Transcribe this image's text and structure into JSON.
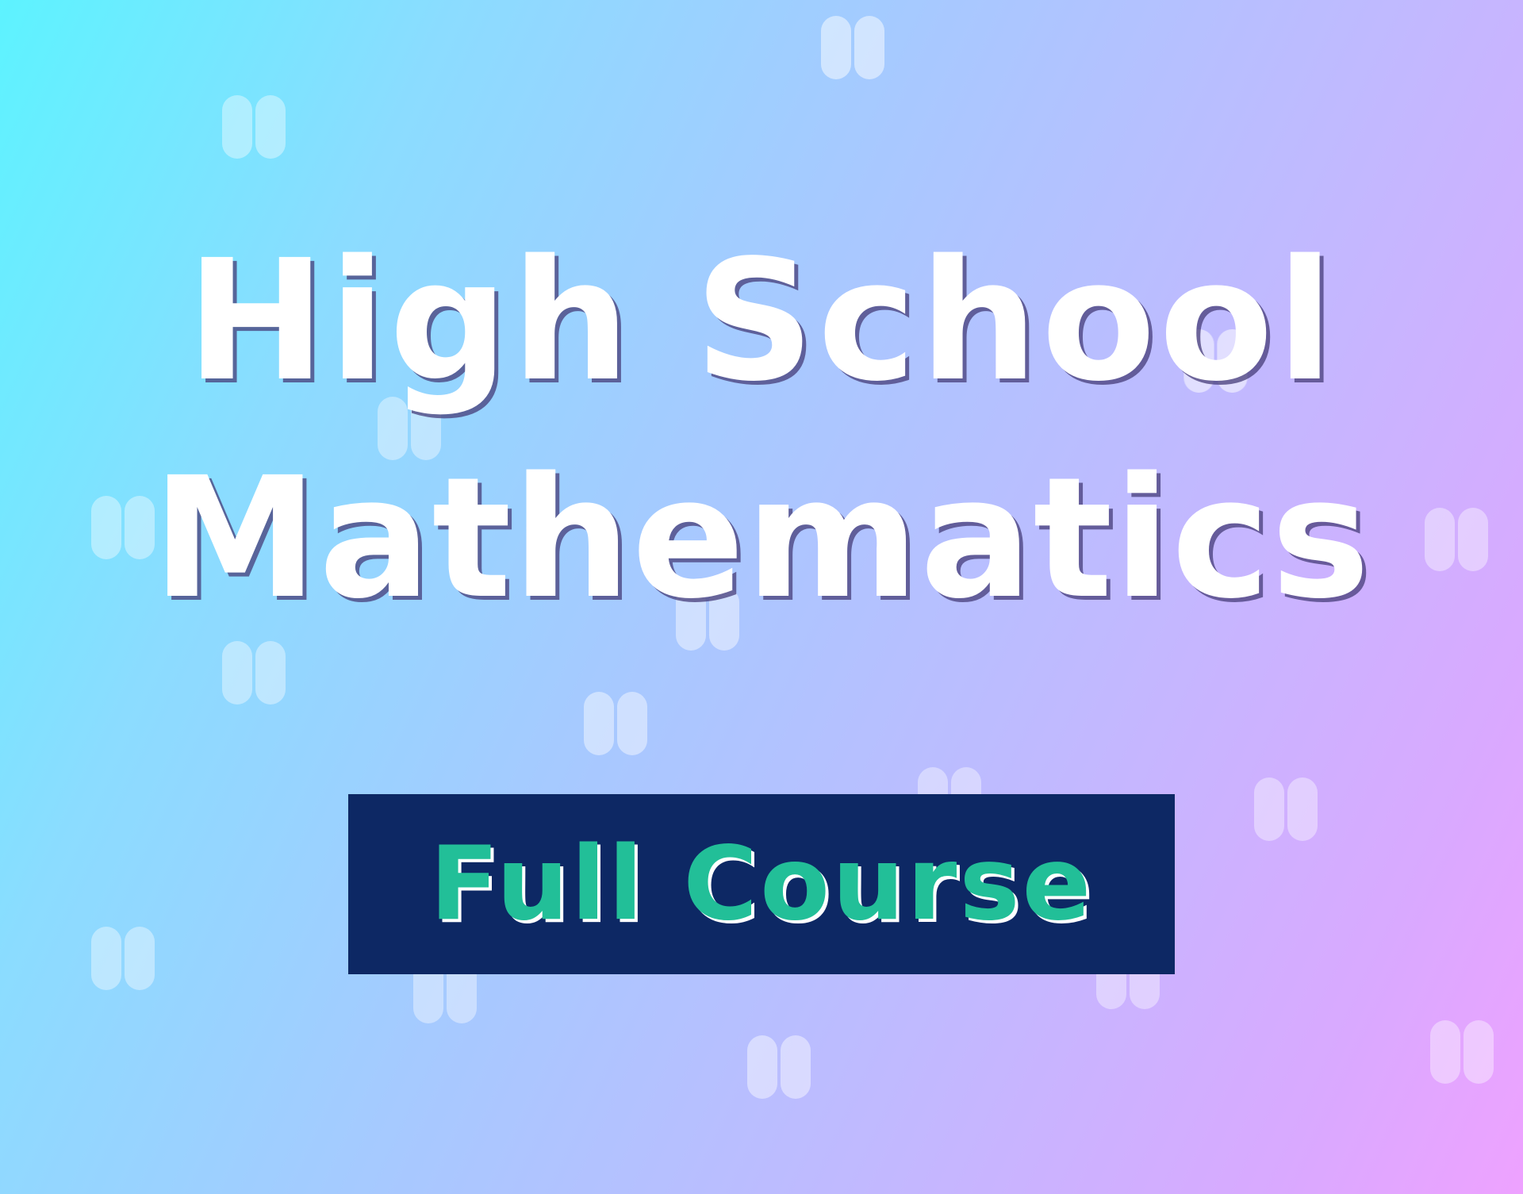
{
  "title": {
    "line1": "High School",
    "line2": "Mathematics"
  },
  "badge": {
    "label": "Full Course"
  },
  "colors": {
    "gradient_start": "#5df3ff",
    "gradient_end": "#eea2ff",
    "title_text": "#ffffff",
    "badge_background": "#0d2864",
    "badge_text": "#22bf98"
  },
  "decoration": {
    "icon": "quote-mark-icon",
    "count": 17
  }
}
